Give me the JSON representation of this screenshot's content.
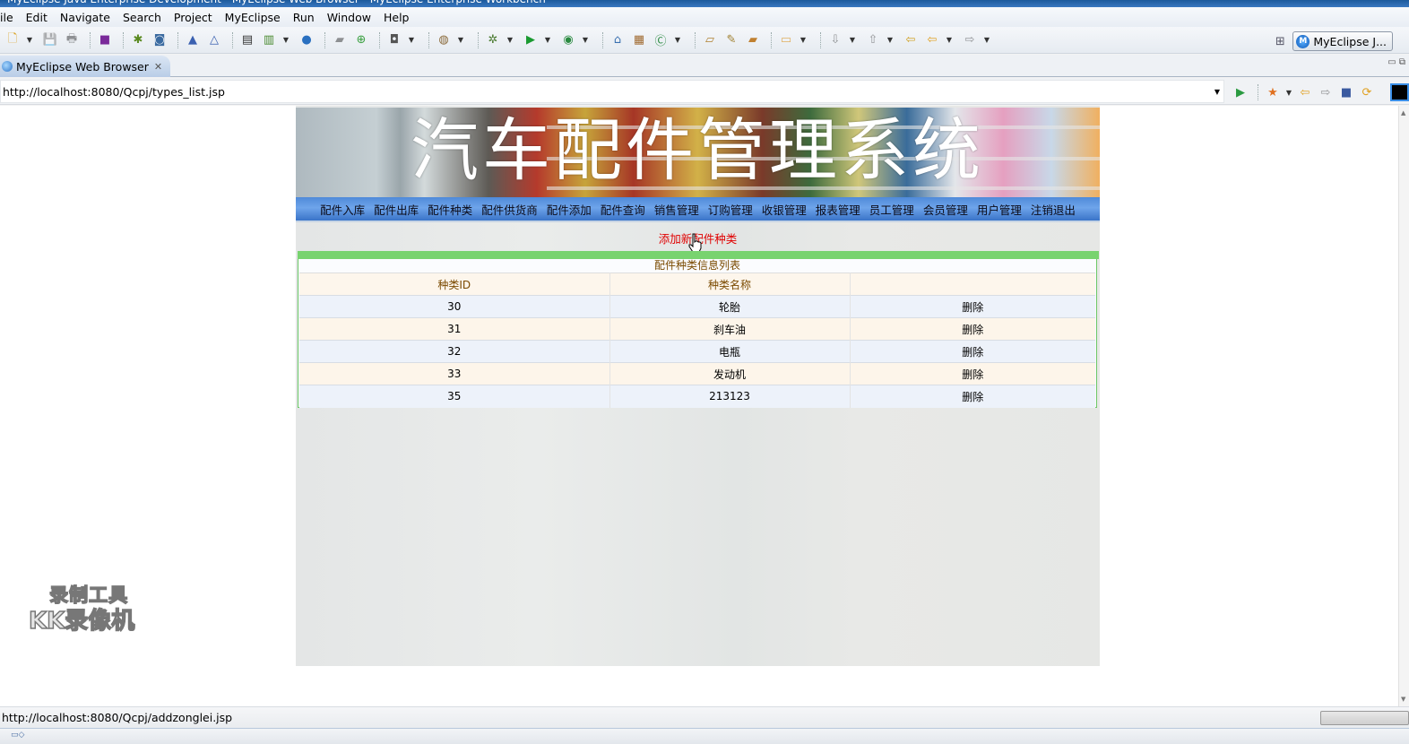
{
  "window": {
    "title": "MyEclipse Java Enterprise Development - MyEclipse Web Browser - MyEclipse Enterprise Workbench"
  },
  "menubar": {
    "items": [
      "ile",
      "Edit",
      "Navigate",
      "Search",
      "Project",
      "MyEclipse",
      "Run",
      "Window",
      "Help"
    ]
  },
  "toolbar": {
    "icons": [
      "new-icon",
      "save-icon",
      "print-icon",
      "package-icon",
      "debug-icon",
      "web20-icon",
      "add-deployment-icon",
      "manage-deployment-icon",
      "server-icon",
      "server-run-icon",
      "browser-icon",
      "open-folder-icon",
      "add-server-icon",
      "screenshot-icon",
      "database-icon",
      "debug-run-icon",
      "run-icon",
      "external-tools-icon",
      "new-web-project-icon",
      "new-package-icon",
      "new-class-icon",
      "open-type-icon",
      "open-task-icon",
      "open-resource-icon",
      "folder-icon",
      "next-annotation-icon",
      "prev-annotation-icon",
      "last-edit-icon",
      "back-icon",
      "forward-icon"
    ],
    "perspective_label": "MyEclipse J...",
    "perspective_icon_letter": "M"
  },
  "editor_tab": {
    "label": "MyEclipse Web Browser",
    "close": "✕"
  },
  "browser": {
    "url": "http://localhost:8080/Qcpj/types_list.jsp",
    "status_url": "http://localhost:8080/Qcpj/addzonglei.jsp"
  },
  "page": {
    "banner_title": "汽车配件管理系统",
    "nav": [
      "配件入库",
      "配件出库",
      "配件种类",
      "配件供货商",
      "配件添加",
      "配件查询",
      "销售管理",
      "订购管理",
      "收银管理",
      "报表管理",
      "员工管理",
      "会员管理",
      "用户管理",
      "注销退出"
    ],
    "add_link": "添加新配件种类",
    "table_caption": "配件种类信息列表",
    "columns": [
      "种类ID",
      "种类名称",
      ""
    ],
    "rows": [
      {
        "id": "30",
        "name": "轮胎",
        "action": "删除"
      },
      {
        "id": "31",
        "name": "刹车油",
        "action": "删除"
      },
      {
        "id": "32",
        "name": "电瓶",
        "action": "删除"
      },
      {
        "id": "33",
        "name": "发动机",
        "action": "删除"
      },
      {
        "id": "35",
        "name": "213123",
        "action": "删除"
      }
    ]
  },
  "watermark": {
    "line1": "录制工具",
    "line2": "KK录像机"
  },
  "colors": {
    "link_red": "#e00000",
    "nav_blue": "#4f8ad9",
    "green_bar": "#78d36f",
    "header_text": "#7a4a00"
  }
}
